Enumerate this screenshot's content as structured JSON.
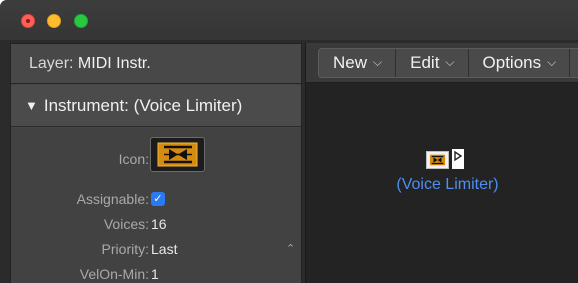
{
  "window": {
    "traffic_lights": [
      "close",
      "minimize",
      "zoom"
    ],
    "colors": {
      "close": "#ff5f57",
      "minimize": "#ffbd2e",
      "zoom": "#28c940"
    }
  },
  "inspector": {
    "layer_label": "Layer:",
    "layer_value": "MIDI Instr.",
    "instrument_label": "Instrument:",
    "instrument_value": "(Voice Limiter)",
    "params": {
      "icon_label": "Icon:",
      "assignable_label": "Assignable:",
      "assignable_checked": true,
      "voices_label": "Voices:",
      "voices_value": "16",
      "priority_label": "Priority:",
      "priority_value": "Last",
      "velon_label": "VelOn-Min:",
      "velon_value": "1"
    }
  },
  "toolbar": {
    "new_label": "New",
    "edit_label": "Edit",
    "options_label": "Options"
  },
  "environment": {
    "object_label": "(Voice Limiter)",
    "label_color": "#4d8ef0"
  }
}
